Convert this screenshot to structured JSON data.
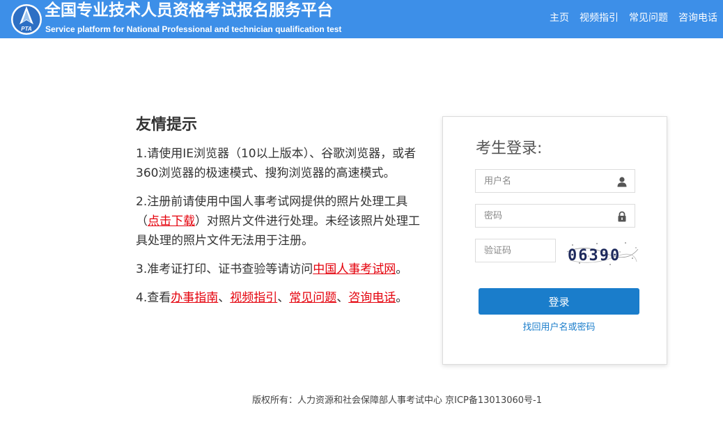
{
  "header": {
    "logo_text": "PTA",
    "title": "全国专业技术人员资格考试报名服务平台",
    "subtitle": "Service platform for National Professional and technician qualification test",
    "nav": [
      "主页",
      "视频指引",
      "常见问题",
      "咨询电话"
    ]
  },
  "tips": {
    "title": "友情提示",
    "tip1": "1.请使用IE浏览器（10以上版本）、谷歌浏览器，或者360浏览器的极速模式、搜狗浏览器的高速模式。",
    "tip2_a": "2.注册前请使用中国人事考试网提供的照片处理工具（",
    "tip2_link": "点击下载",
    "tip2_b": "）对照片文件进行处理。未经该照片处理工具处理的照片文件无法用于注册。",
    "tip3_a": "3.准考证打印、证书查验等请访问",
    "tip3_link": "中国人事考试网",
    "tip3_b": "。",
    "tip4_a": "4.查看",
    "tip4_links": [
      "办事指南",
      "视频指引",
      "常见问题",
      "咨询电话"
    ],
    "tip4_sep": "、",
    "tip4_end": "。"
  },
  "login": {
    "title": "考生登录:",
    "username_placeholder": "用户名",
    "password_placeholder": "密码",
    "captcha_placeholder": "验证码",
    "captcha_code": "06390",
    "button": "登录",
    "forgot": "找回用户名或密码"
  },
  "footer": {
    "text": "版权所有：人力资源和社会保障部人事考试中心 京ICP备13013060号-1"
  },
  "colors": {
    "header_bg": "#3d8fe8",
    "button_bg": "#1a7dcb",
    "link_red": "#e4000b"
  }
}
